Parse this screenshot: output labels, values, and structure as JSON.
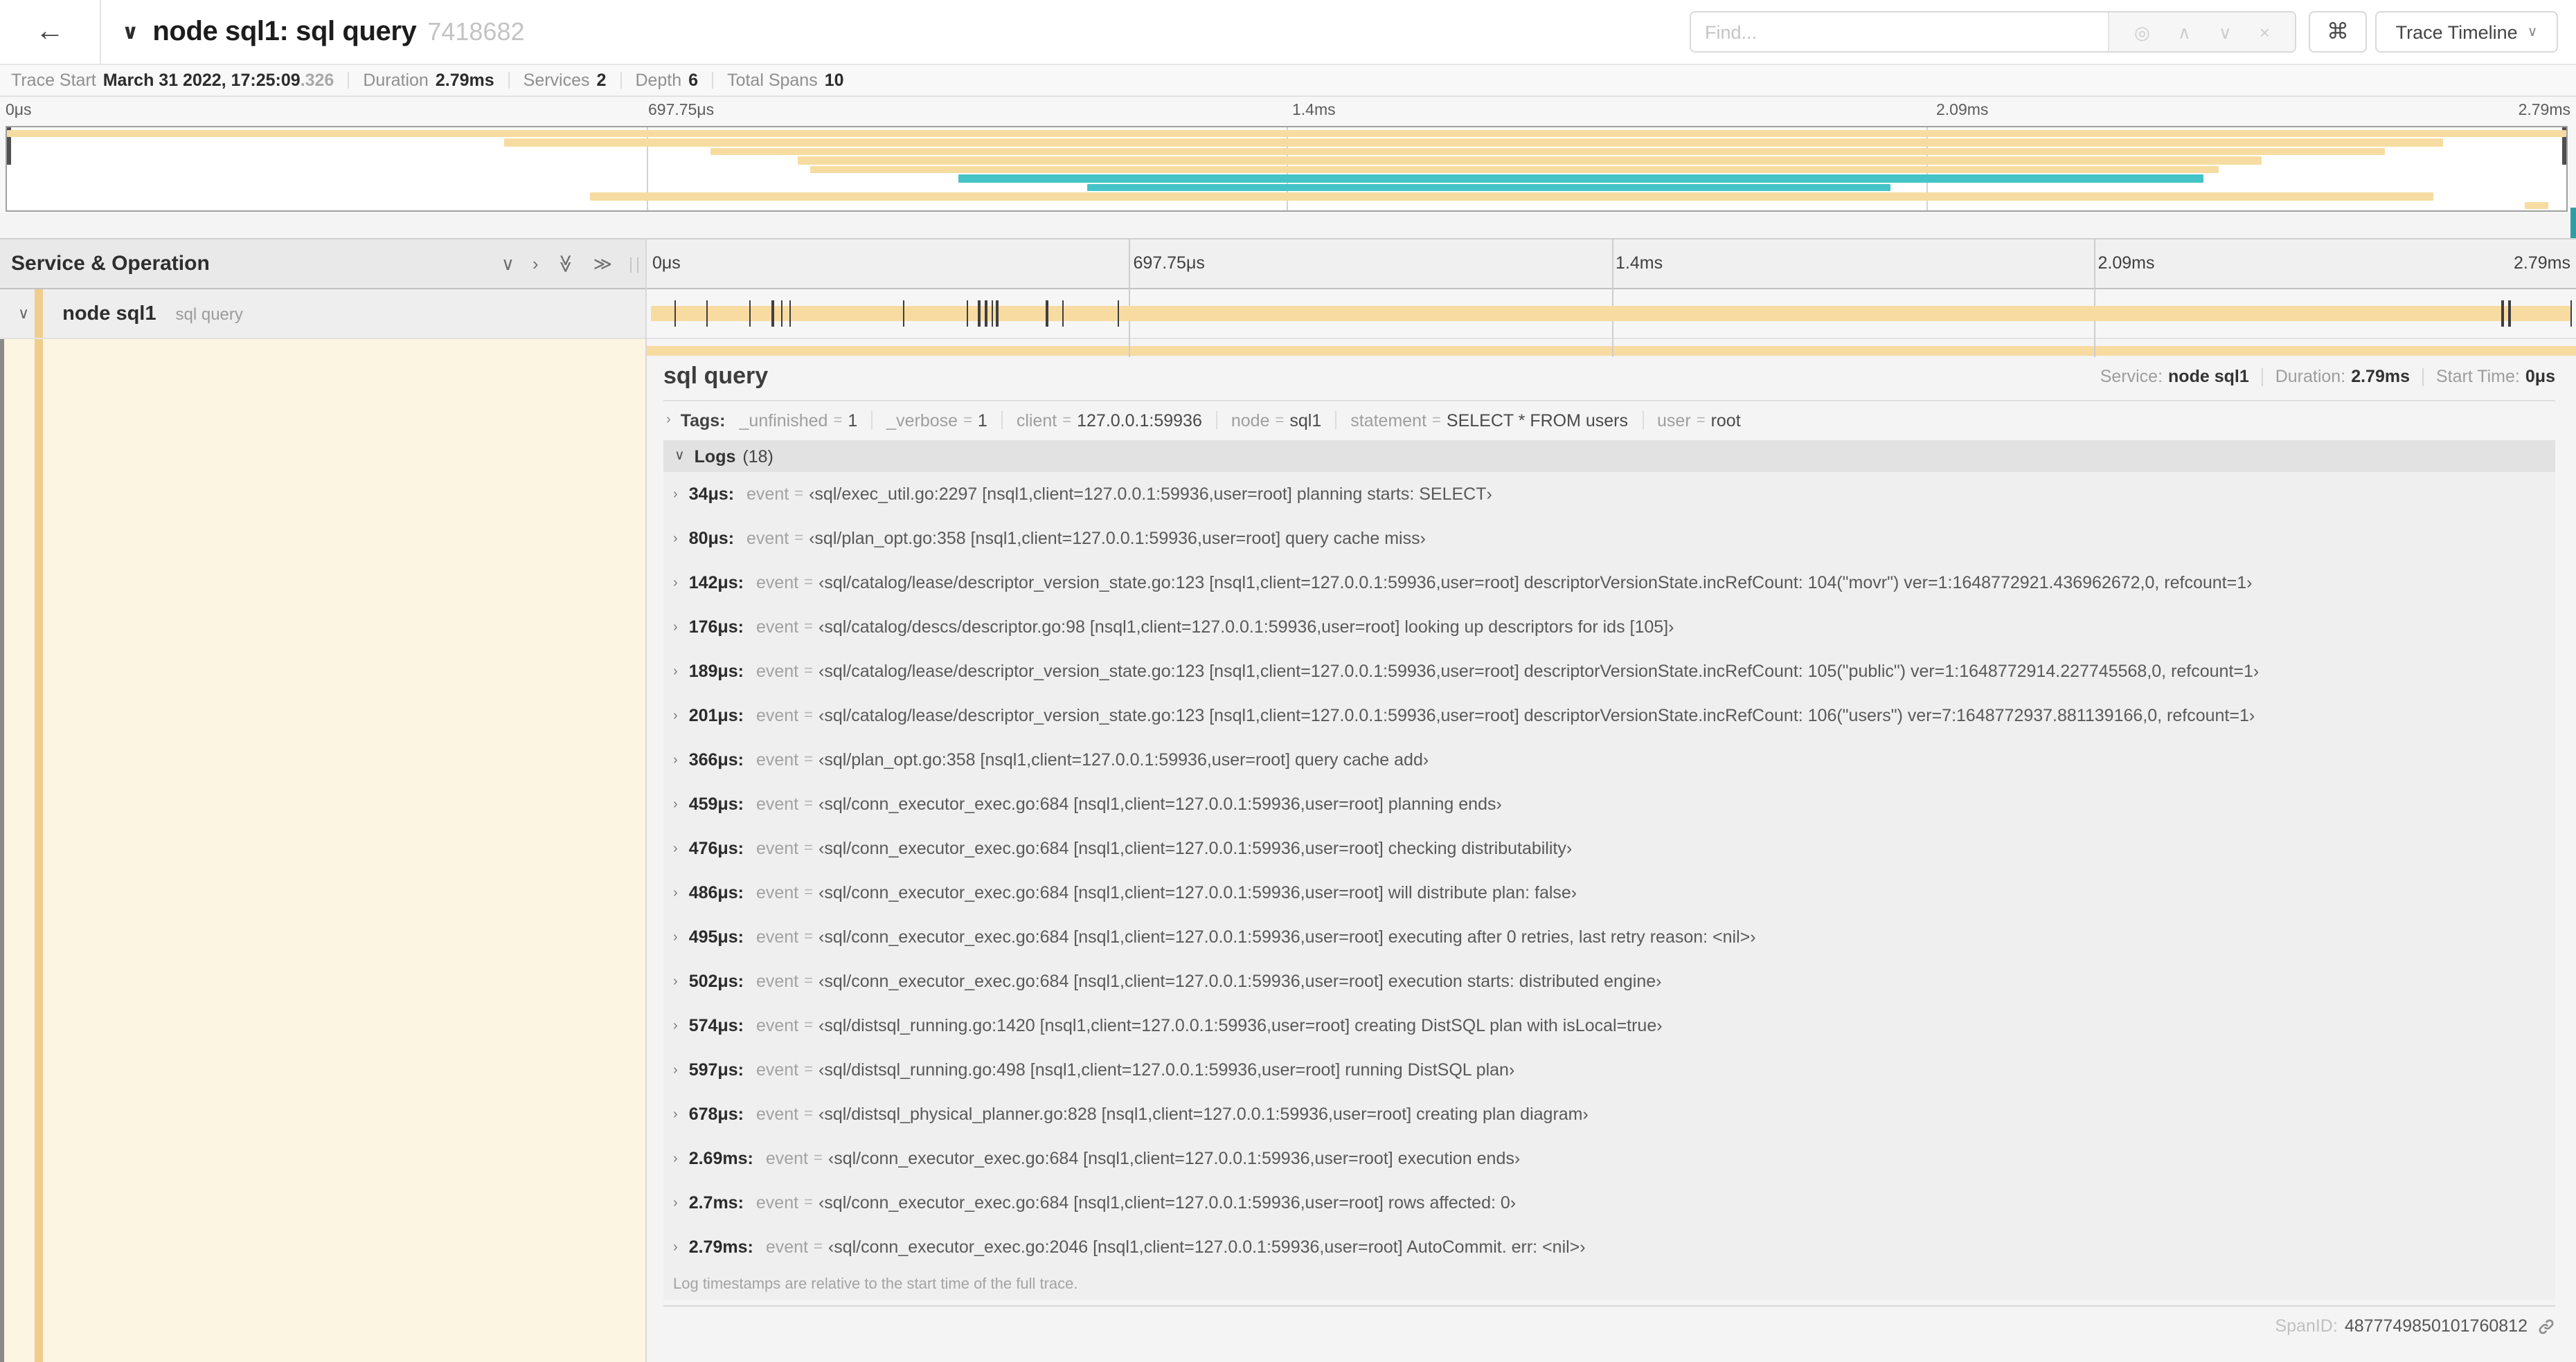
{
  "colors": {
    "tan": "#f7dca2",
    "teal": "#44c4c7",
    "accent_tan": "#f0cd8d"
  },
  "icons": {
    "back": "←",
    "title_collapse": "∨",
    "locate": "◎",
    "prev": "∧",
    "next": "∨",
    "clear": "×",
    "keyboard": "⌘",
    "dropdown": "∨",
    "collapse_one": "∨",
    "expand_one": "›",
    "collapse_all": "≫",
    "expand_all": "≫",
    "row_chevron": "∨",
    "tags_chevron": "›",
    "logs_chevron": "∨",
    "log_chevron": "›"
  },
  "header": {
    "title": "node sql1: sql query",
    "trace_id": "7418682",
    "find_placeholder": "Find...",
    "view_selector_label": "Trace Timeline"
  },
  "summary": {
    "items": [
      {
        "label": "Trace Start",
        "value": "March 31 2022, 17:25:09",
        "suffix": ".326"
      },
      {
        "label": "Duration",
        "value": "2.79ms",
        "suffix": ""
      },
      {
        "label": "Services",
        "value": "2",
        "suffix": ""
      },
      {
        "label": "Depth",
        "value": "6",
        "suffix": ""
      },
      {
        "label": "Total Spans",
        "value": "10",
        "suffix": ""
      }
    ]
  },
  "axis_ticks": [
    "0μs",
    "697.75μs",
    "1.4ms",
    "2.09ms",
    "2.79ms"
  ],
  "minimap": {
    "spans": [
      {
        "start_pct": 0,
        "end_pct": 100,
        "color": "tan"
      },
      {
        "start_pct": 19.4,
        "end_pct": 95.2,
        "color": "tan"
      },
      {
        "start_pct": 27.5,
        "end_pct": 92.9,
        "color": "tan"
      },
      {
        "start_pct": 30.9,
        "end_pct": 88.1,
        "color": "tan"
      },
      {
        "start_pct": 31.4,
        "end_pct": 86.4,
        "color": "tan"
      },
      {
        "start_pct": 37.2,
        "end_pct": 85.8,
        "color": "teal"
      },
      {
        "start_pct": 42.2,
        "end_pct": 73.6,
        "color": "teal"
      },
      {
        "start_pct": 22.8,
        "end_pct": 94.8,
        "color": "tan"
      },
      {
        "start_pct": 98.4,
        "end_pct": 99.3,
        "color": "tan"
      }
    ]
  },
  "timeline_header": {
    "left_title": "Service & Operation"
  },
  "span_row": {
    "service": "node sql1",
    "operation": "sql query",
    "total_us": 2790,
    "log_marks_us": [
      34,
      80,
      142,
      176,
      189,
      201,
      366,
      459,
      476,
      486,
      495,
      502,
      574,
      597,
      678,
      2690,
      2700,
      2790
    ]
  },
  "detail": {
    "title": "sql query",
    "meta": [
      {
        "label": "Service:",
        "value": "node sql1"
      },
      {
        "label": "Duration:",
        "value": "2.79ms"
      },
      {
        "label": "Start Time:",
        "value": "0μs"
      }
    ],
    "tags_label": "Tags:",
    "tags": [
      {
        "key": "_unfinished",
        "value": "1"
      },
      {
        "key": "_verbose",
        "value": "1"
      },
      {
        "key": "client",
        "value": "127.0.0.1:59936"
      },
      {
        "key": "node",
        "value": "sql1"
      },
      {
        "key": "statement",
        "value": "SELECT * FROM users"
      },
      {
        "key": "user",
        "value": "root"
      }
    ],
    "logs_label": "Logs",
    "logs_count": "(18)",
    "logs": [
      {
        "time": "34μs:",
        "key": "event",
        "value": "‹sql/exec_util.go:2297 [nsql1,client=127.0.0.1:59936,user=root] planning starts: SELECT›"
      },
      {
        "time": "80μs:",
        "key": "event",
        "value": "‹sql/plan_opt.go:358 [nsql1,client=127.0.0.1:59936,user=root] query cache miss›"
      },
      {
        "time": "142μs:",
        "key": "event",
        "value": "‹sql/catalog/lease/descriptor_version_state.go:123 [nsql1,client=127.0.0.1:59936,user=root] descriptorVersionState.incRefCount: 104(\"movr\") ver=1:1648772921.436962672,0, refcount=1›"
      },
      {
        "time": "176μs:",
        "key": "event",
        "value": "‹sql/catalog/descs/descriptor.go:98 [nsql1,client=127.0.0.1:59936,user=root] looking up descriptors for ids [105]›"
      },
      {
        "time": "189μs:",
        "key": "event",
        "value": "‹sql/catalog/lease/descriptor_version_state.go:123 [nsql1,client=127.0.0.1:59936,user=root] descriptorVersionState.incRefCount: 105(\"public\") ver=1:1648772914.227745568,0, refcount=1›"
      },
      {
        "time": "201μs:",
        "key": "event",
        "value": "‹sql/catalog/lease/descriptor_version_state.go:123 [nsql1,client=127.0.0.1:59936,user=root] descriptorVersionState.incRefCount: 106(\"users\") ver=7:1648772937.881139166,0, refcount=1›"
      },
      {
        "time": "366μs:",
        "key": "event",
        "value": "‹sql/plan_opt.go:358 [nsql1,client=127.0.0.1:59936,user=root] query cache add›"
      },
      {
        "time": "459μs:",
        "key": "event",
        "value": "‹sql/conn_executor_exec.go:684 [nsql1,client=127.0.0.1:59936,user=root] planning ends›"
      },
      {
        "time": "476μs:",
        "key": "event",
        "value": "‹sql/conn_executor_exec.go:684 [nsql1,client=127.0.0.1:59936,user=root] checking distributability›"
      },
      {
        "time": "486μs:",
        "key": "event",
        "value": "‹sql/conn_executor_exec.go:684 [nsql1,client=127.0.0.1:59936,user=root] will distribute plan: false›"
      },
      {
        "time": "495μs:",
        "key": "event",
        "value": "‹sql/conn_executor_exec.go:684 [nsql1,client=127.0.0.1:59936,user=root] executing after 0 retries, last retry reason: <nil>›"
      },
      {
        "time": "502μs:",
        "key": "event",
        "value": "‹sql/conn_executor_exec.go:684 [nsql1,client=127.0.0.1:59936,user=root] execution starts: distributed engine›"
      },
      {
        "time": "574μs:",
        "key": "event",
        "value": "‹sql/distsql_running.go:1420 [nsql1,client=127.0.0.1:59936,user=root] creating DistSQL plan with isLocal=true›"
      },
      {
        "time": "597μs:",
        "key": "event",
        "value": "‹sql/distsql_running.go:498 [nsql1,client=127.0.0.1:59936,user=root] running DistSQL plan›"
      },
      {
        "time": "678μs:",
        "key": "event",
        "value": "‹sql/distsql_physical_planner.go:828 [nsql1,client=127.0.0.1:59936,user=root] creating plan diagram›"
      },
      {
        "time": "2.69ms:",
        "key": "event",
        "value": "‹sql/conn_executor_exec.go:684 [nsql1,client=127.0.0.1:59936,user=root] execution ends›"
      },
      {
        "time": "2.7ms:",
        "key": "event",
        "value": "‹sql/conn_executor_exec.go:684 [nsql1,client=127.0.0.1:59936,user=root] rows affected: 0›"
      },
      {
        "time": "2.79ms:",
        "key": "event",
        "value": "‹sql/conn_executor_exec.go:2046 [nsql1,client=127.0.0.1:59936,user=root] AutoCommit. err: <nil>›"
      }
    ],
    "footer_note": "Log timestamps are relative to the start time of the full trace.",
    "span_id_label": "SpanID:",
    "span_id": "4877749850101760812"
  }
}
